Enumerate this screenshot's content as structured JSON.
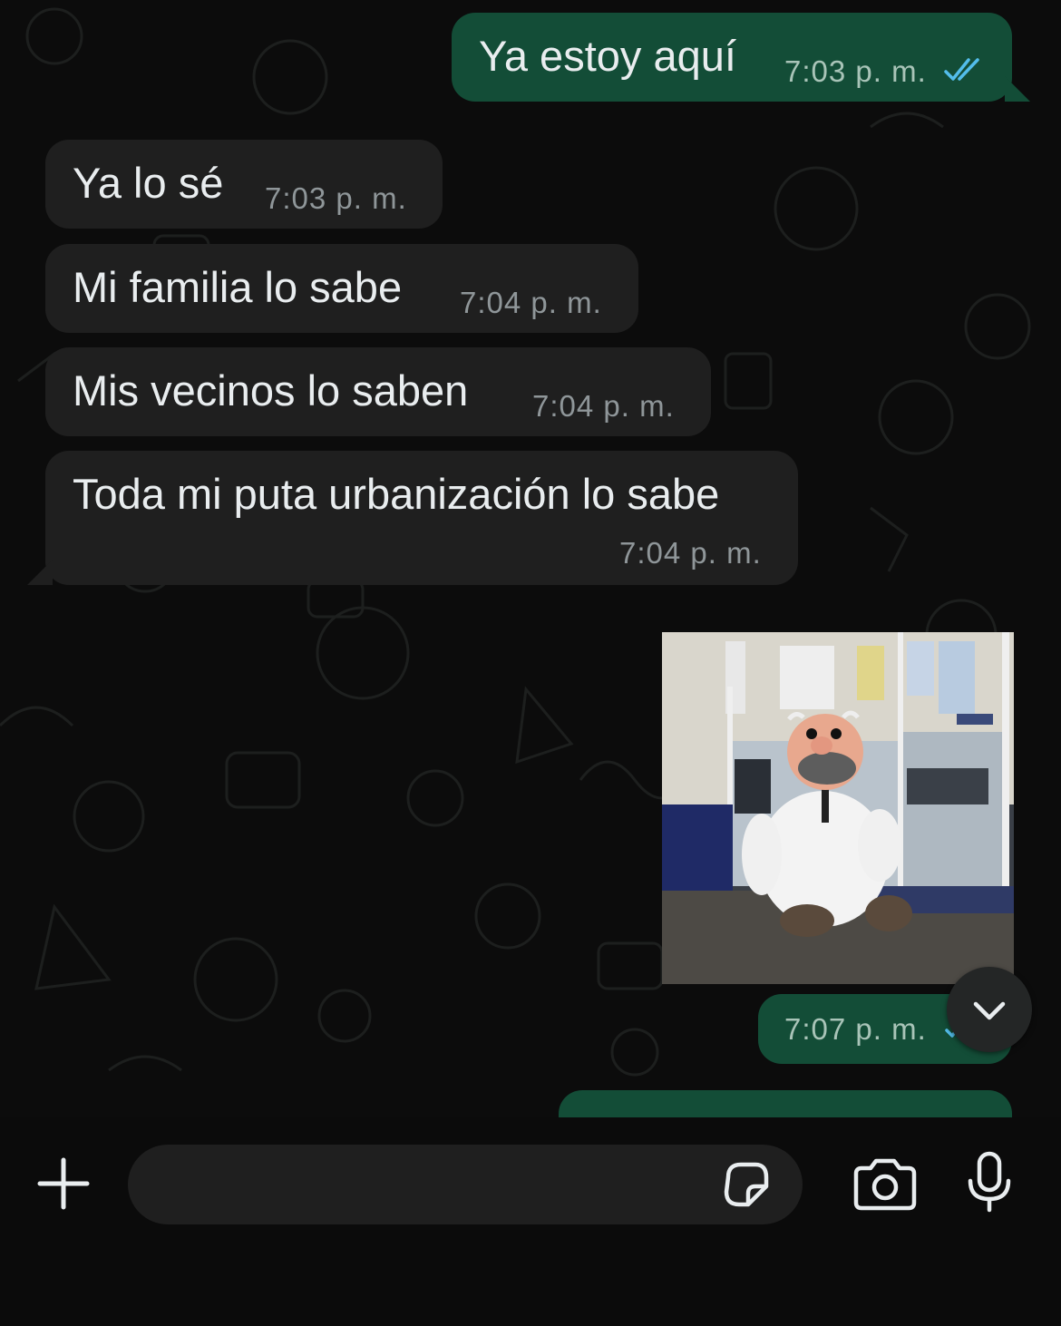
{
  "messages": [
    {
      "direction": "outgoing",
      "text": "Ya estoy aquí",
      "time": "7:03",
      "ampm": "p. m.",
      "status": "read"
    },
    {
      "direction": "incoming",
      "text": "Ya lo sé",
      "time": "7:03",
      "ampm": "p. m."
    },
    {
      "direction": "incoming",
      "text": "Mi familia lo sabe",
      "time": "7:04",
      "ampm": "p. m."
    },
    {
      "direction": "incoming",
      "text": "Mis vecinos lo saben",
      "time": "7:04",
      "ampm": "p. m."
    },
    {
      "direction": "incoming",
      "text": "Toda mi puta urbanización lo sabe",
      "time": "7:04",
      "ampm": "p. m."
    },
    {
      "direction": "outgoing",
      "type": "sticker",
      "image": "cartoon-doctor-sitting",
      "time": "7:07",
      "ampm": "p. m.",
      "status": "read"
    }
  ],
  "composer": {
    "placeholder": "",
    "icons": [
      "plus-icon",
      "sticker-icon",
      "camera-icon",
      "microphone-icon"
    ]
  },
  "colors": {
    "background": "#0c0c0c",
    "incoming_bubble": "#1f1f1f",
    "outgoing_bubble": "#134d37",
    "read_ticks": "#53bdeb"
  }
}
